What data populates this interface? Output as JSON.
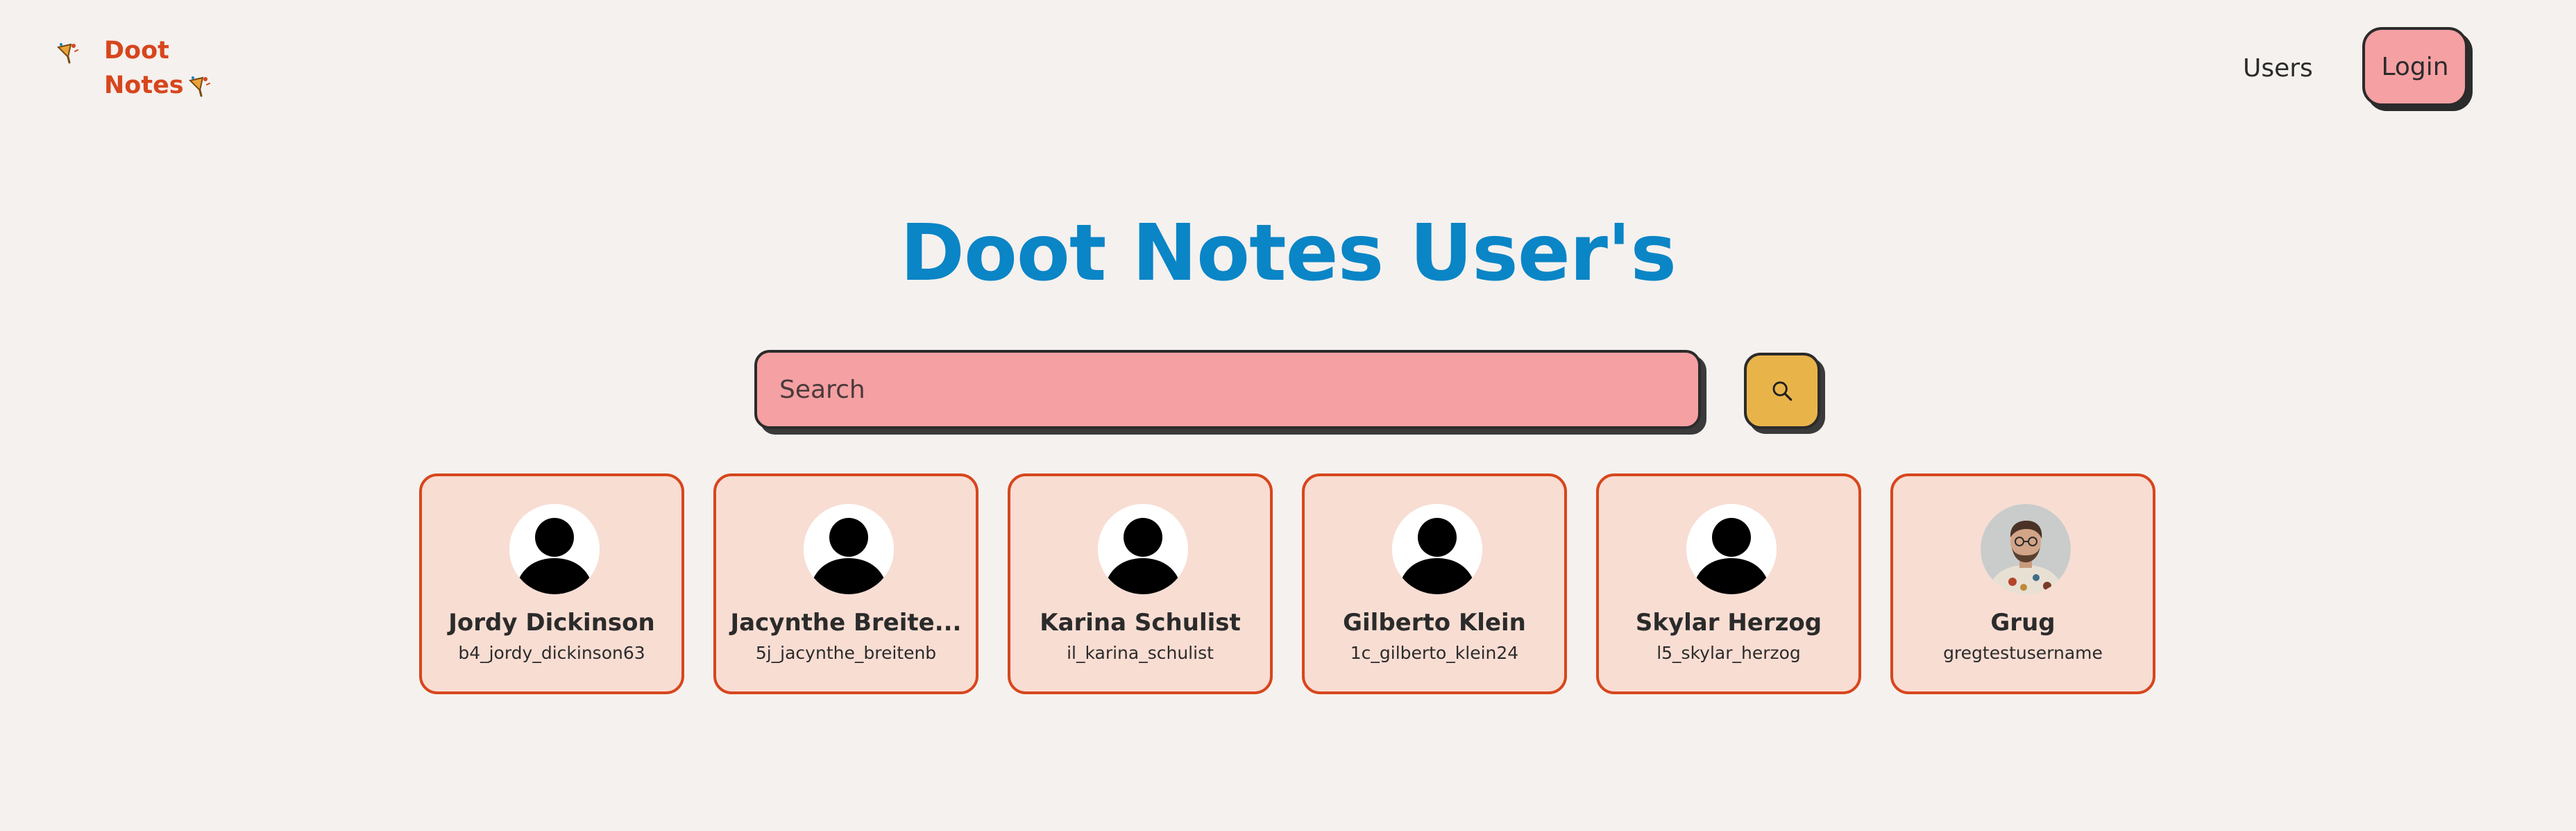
{
  "header": {
    "brand_line1": "Doot",
    "brand_line2": "Notes",
    "nav_users": "Users",
    "login_label": "Login"
  },
  "main": {
    "title": "Doot Notes User's",
    "search_placeholder": "Search",
    "search_icon": "search-icon"
  },
  "colors": {
    "background": "#f5f1ee",
    "brand": "#d7461d",
    "title": "#0a85c6",
    "pink": "#f5a0a3",
    "search_button": "#e8b44a",
    "card_fill": "#f8ddd3",
    "card_border": "#d7461d"
  },
  "users": [
    {
      "name": "Jordy Dickinson",
      "username": "b4_jordy_dickinson63",
      "avatar": "default-avatar-icon"
    },
    {
      "name": "Jacynthe Breite...",
      "username": "5j_jacynthe_breitenb",
      "avatar": "default-avatar-icon"
    },
    {
      "name": "Karina Schulist",
      "username": "il_karina_schulist",
      "avatar": "default-avatar-icon"
    },
    {
      "name": "Gilberto Klein",
      "username": "1c_gilberto_klein24",
      "avatar": "default-avatar-icon"
    },
    {
      "name": "Skylar Herzog",
      "username": "l5_skylar_herzog",
      "avatar": "default-avatar-icon"
    },
    {
      "name": "Grug",
      "username": "gregtestusername",
      "avatar": "photo-avatar"
    }
  ]
}
